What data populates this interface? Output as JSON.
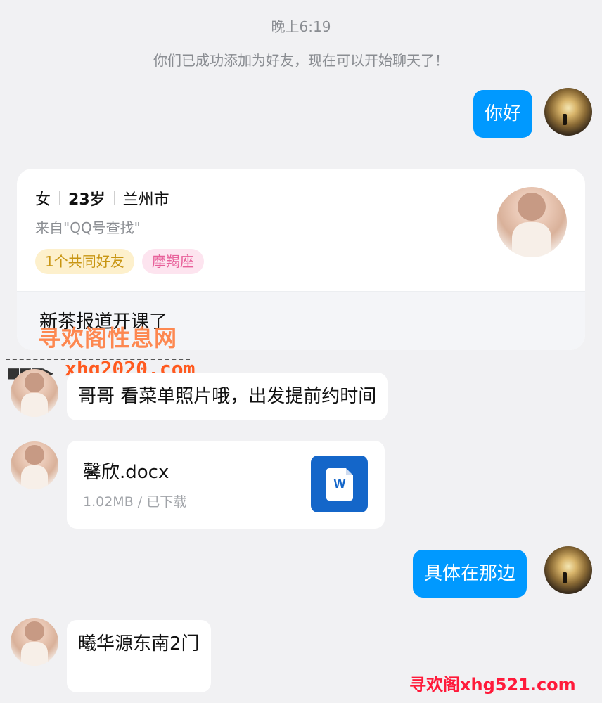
{
  "timestamp": "晚上6:19",
  "system_message": "你们已成功添加为好友，现在可以开始聊天了！",
  "messages": {
    "m1_text": "你好",
    "m2_text": "哥哥  看菜单照片哦，出发提前约时间",
    "m4_text": "具体在那边",
    "m5_text": "曦华源东南2门"
  },
  "profile_card": {
    "gender": "女",
    "age": "23岁",
    "city": "兰州市",
    "source": "来自\"QQ号查找\"",
    "tag_friends": "1个共同好友",
    "tag_zodiac": "摩羯座",
    "status": "新茶报道开课了"
  },
  "file": {
    "name": "馨欣.docx",
    "meta": "1.02MB / 已下载",
    "icon_letter": "W",
    "icon": "word-file-icon"
  },
  "watermarks": {
    "overlay_cn": "寻欢阁性息网",
    "overlay_url": "xhg2020.com",
    "overlay_arrow": "■■■▶",
    "bottom": "寻欢阁xhg521.com"
  },
  "colors": {
    "self_bubble": "#0099ff",
    "background": "#f1f1f3",
    "tag_friends": "#c89512",
    "tag_zodiac": "#e8609a",
    "word_icon": "#1466c9"
  }
}
